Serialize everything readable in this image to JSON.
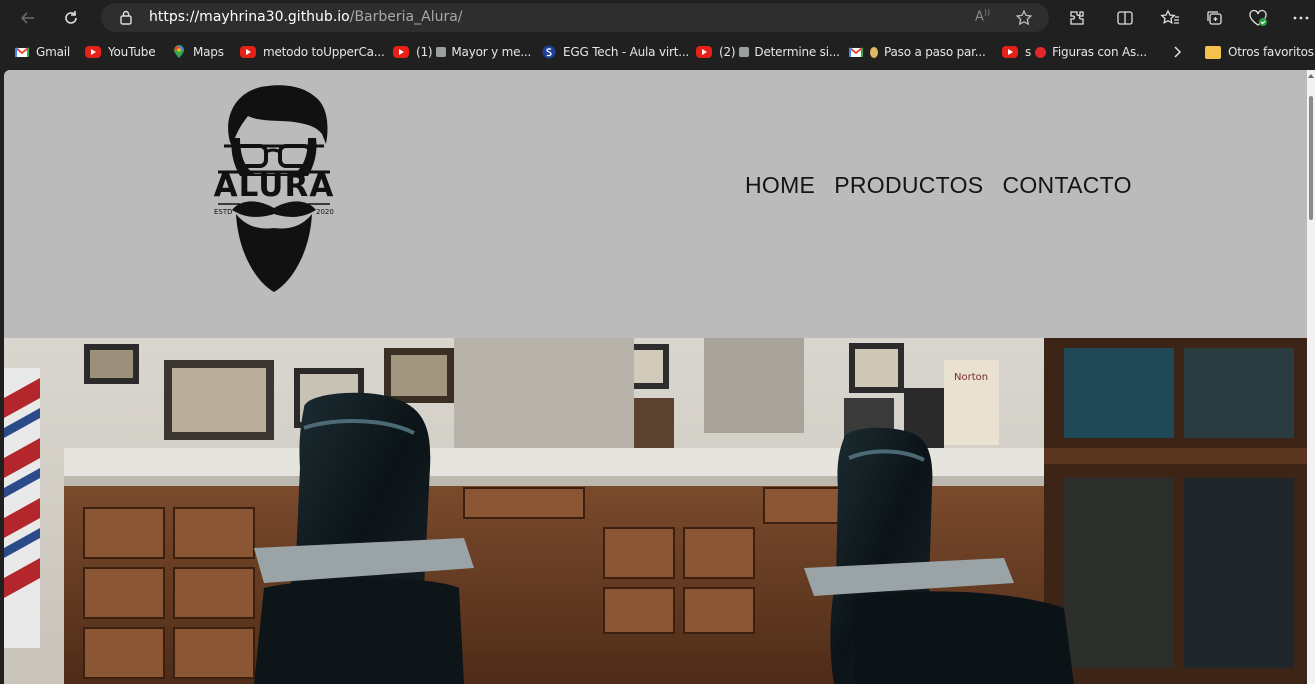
{
  "browser": {
    "url_host": "https://mayhrina30.github.io",
    "url_path": "/Barberia_Alura/",
    "icons": {
      "back": "back-arrow-icon",
      "reload": "reload-icon",
      "lock": "lock-icon",
      "read_aloud": "read-aloud-icon",
      "favorite": "star-icon",
      "extensions": "puzzle-icon",
      "split": "split-screen-icon",
      "favorites": "favorites-icon",
      "collections": "collections-icon",
      "health": "browser-essentials-icon",
      "more": "more-icon"
    }
  },
  "bookmarks": [
    {
      "label": "Gmail",
      "icon": "gmail-icon"
    },
    {
      "label": "YouTube",
      "icon": "youtube-icon"
    },
    {
      "label": "Maps",
      "icon": "maps-icon"
    },
    {
      "label": "metodo toUpperCa...",
      "icon": "youtube-icon"
    },
    {
      "prefix": "(1)",
      "label": "Mayor y me...",
      "icon": "youtube-icon"
    },
    {
      "label": "EGG Tech - Aula virt...",
      "icon": "egg-icon"
    },
    {
      "prefix": "(2)",
      "label": "Determine si...",
      "icon": "youtube-icon"
    },
    {
      "label": "Paso a paso par...",
      "icon": "gmail-icon"
    },
    {
      "prefix": "s",
      "label": "Figuras con As...",
      "icon": "youtube-icon"
    }
  ],
  "other_favorites": "Otros favoritos",
  "site": {
    "logo": {
      "word": "ALURA",
      "estd": "ESTD",
      "year": "2020"
    },
    "nav": [
      "HOME",
      "PRODUCTOS",
      "CONTACTO"
    ],
    "hero_alt": "barbershop-interior-photo"
  },
  "colors": {
    "header_bg": "#bbbbbb",
    "browser_bg": "#202020",
    "nav_text": "#141414"
  }
}
